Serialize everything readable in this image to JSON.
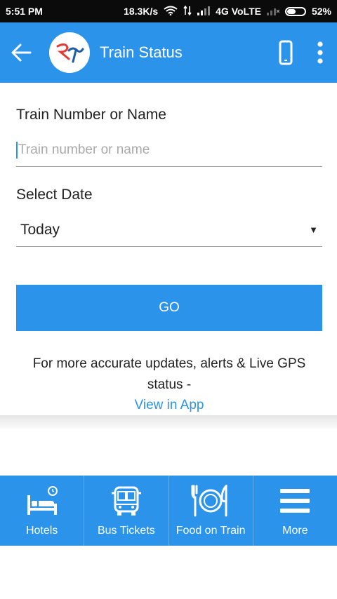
{
  "status_bar": {
    "time": "5:51 PM",
    "network_speed": "18.3K/s",
    "network_type": "4G VoLTE",
    "battery": "52%",
    "battery_level": 0.52
  },
  "app_bar": {
    "title": "Train Status",
    "back_icon": "arrow-left-icon",
    "logo_icon": "ry-logo",
    "phone_icon": "phone-icon",
    "menu_icon": "more-vert-icon"
  },
  "form": {
    "train_label": "Train Number or Name",
    "train_placeholder": "Train number or name",
    "date_label": "Select Date",
    "date_value": "Today",
    "go_label": "GO"
  },
  "promo": {
    "text": "For more accurate updates, alerts & Live GPS status -",
    "link": "View in App"
  },
  "bottom_nav": {
    "items": [
      {
        "label": "Hotels",
        "icon": "hotel-bed-icon"
      },
      {
        "label": "Bus Tickets",
        "icon": "bus-icon"
      },
      {
        "label": "Food on Train",
        "icon": "food-plate-icon"
      },
      {
        "label": "More",
        "icon": "hamburger-menu-icon"
      }
    ]
  },
  "colors": {
    "primary": "#2b93e9",
    "status_bar": "#0b0b0b",
    "text": "#222222",
    "placeholder": "#a9a9a9"
  }
}
